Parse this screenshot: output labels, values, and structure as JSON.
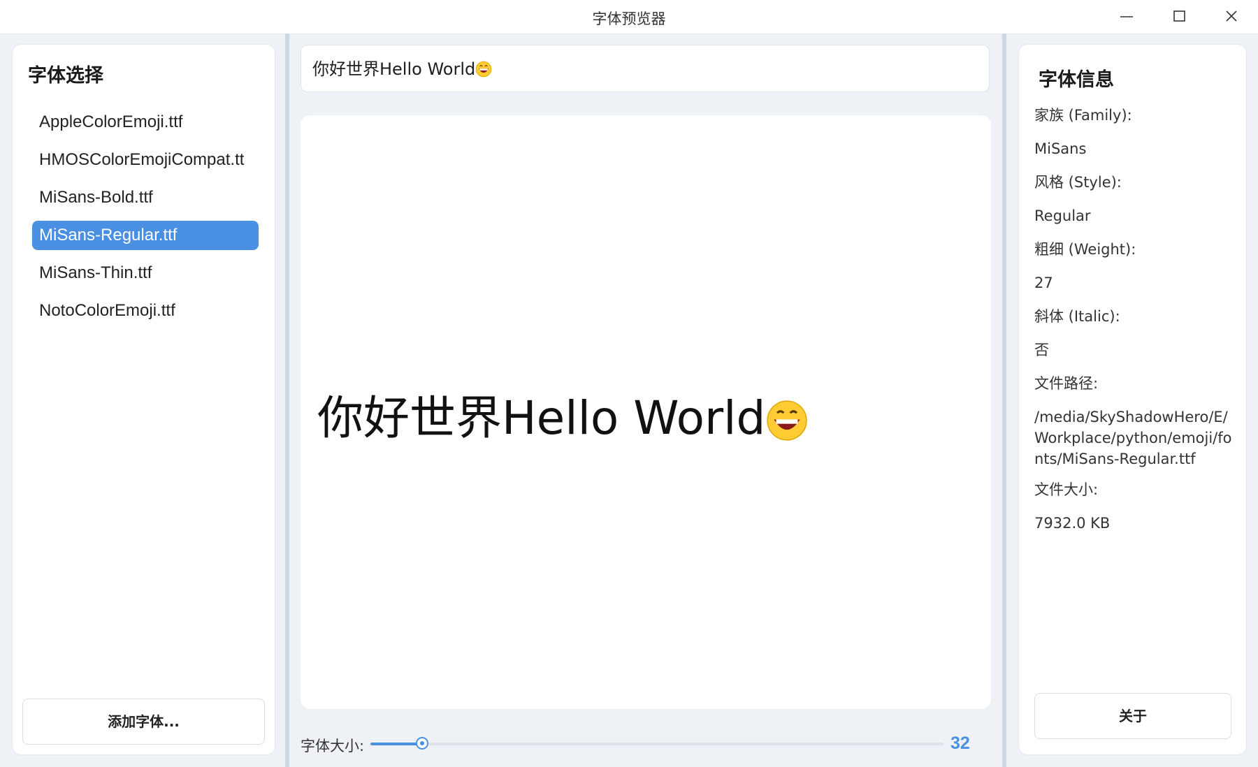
{
  "window": {
    "title": "字体预览器",
    "controls": [
      "minimize-icon",
      "maximize-icon",
      "close-icon"
    ]
  },
  "font_panel": {
    "heading": "字体选择",
    "items": [
      {
        "label": "AppleColorEmoji.ttf",
        "selected": false
      },
      {
        "label": "HMOSColorEmojiCompat.tt",
        "selected": false
      },
      {
        "label": "MiSans-Bold.ttf",
        "selected": false
      },
      {
        "label": "MiSans-Regular.ttf",
        "selected": true
      },
      {
        "label": "MiSans-Thin.ttf",
        "selected": false
      },
      {
        "label": "NotoColorEmoji.ttf",
        "selected": false
      }
    ],
    "add_button": "添加字体..."
  },
  "preview": {
    "input_text": "你好世界Hello World",
    "preview_text": "你好世界Hello World",
    "emoji_icon": "grinning-face-emoji-icon",
    "size_label": "字体大小:",
    "size_value": "32",
    "slider_fraction": 0.09
  },
  "info_panel": {
    "heading": "字体信息",
    "family_label": "家族 (Family):",
    "family_value": "MiSans",
    "style_label": "风格 (Style):",
    "style_value": "Regular",
    "weight_label": "粗细 (Weight):",
    "weight_value": "27",
    "italic_label": "斜体 (Italic):",
    "italic_value": "否",
    "path_label": "文件路径:",
    "path_value": "/media/SkyShadowHero/E/Workplace/python/emoji/fonts/MiSans-Regular.ttf",
    "size_label": "文件大小:",
    "size_value": "7932.0 KB",
    "about_button": "关于"
  },
  "colors": {
    "accent": "#4a90e2",
    "background": "#eef2f6",
    "panel": "#ffffff"
  }
}
